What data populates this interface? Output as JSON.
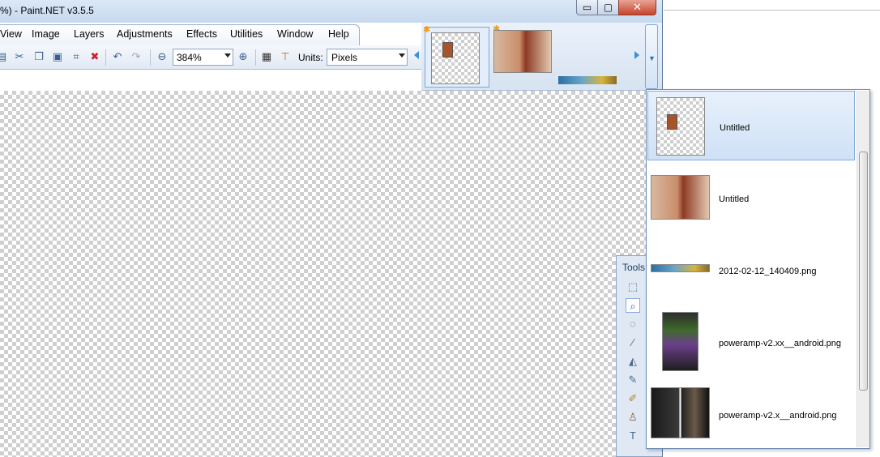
{
  "window": {
    "title": "%) - Paint.NET v3.5.5",
    "controls": {
      "minimize": "▭",
      "maximize": "▢",
      "close": "✕"
    }
  },
  "menu": [
    "View",
    "Image",
    "Layers",
    "Adjustments",
    "Effects",
    "Utilities",
    "Window",
    "Help"
  ],
  "toolbar": {
    "zoom_value": "384%",
    "units_label": "Units:",
    "units_value": "Pixels",
    "icons": [
      "crop-to-selection-icon",
      "cut-icon",
      "copy-icon",
      "paste-icon",
      "crop-icon",
      "deselect-icon",
      "undo-icon",
      "redo-icon",
      "zoom-out-icon",
      "zoom-in-icon",
      "grid-icon",
      "ruler-icon"
    ]
  },
  "image_strip": {
    "selected_index": 0
  },
  "image_list": {
    "items": [
      {
        "label": "Untitled"
      },
      {
        "label": "Untitled"
      },
      {
        "label": "2012-02-12_140409.png"
      },
      {
        "label": "poweramp-v2.xx__android.png"
      },
      {
        "label": "poweramp-v2.x__android.png"
      }
    ],
    "selected_index": 0
  },
  "tools_window": {
    "title": "Tools"
  },
  "colors": {
    "accent": "#3d8fd8",
    "selection": "#cfe1f6",
    "close_button": "#c7432b",
    "modified_star": "#f29b1d"
  }
}
